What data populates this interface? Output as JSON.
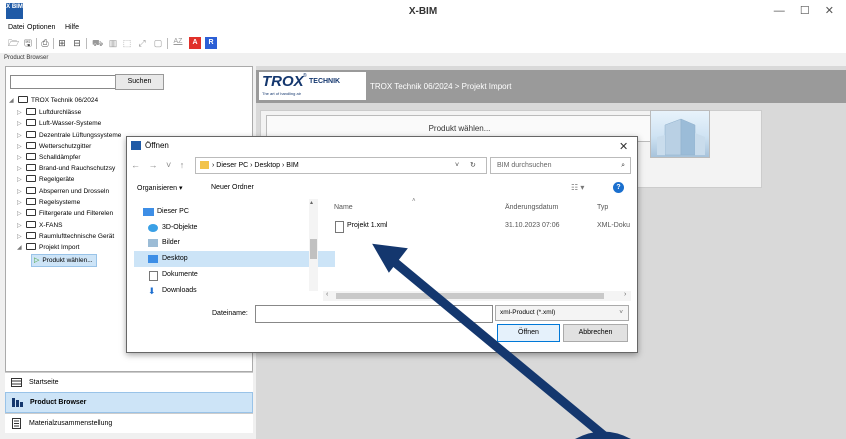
{
  "app": {
    "title": "X-BIM",
    "logo_text": "X BIM",
    "window_controls": "— ☐ ✕"
  },
  "menu": [
    "Datei",
    "Optionen",
    "Hilfe"
  ],
  "toolbar": {
    "icons": [
      "open-folder",
      "save",
      "print",
      "add-box",
      "expand-box",
      "cart",
      "product-list",
      "frame",
      "expand-arrow",
      "sort-az",
      "a-red",
      "r-blue"
    ],
    "az_label": "AZ",
    "a_label": "A",
    "r_label": "R",
    "accent_red": "#e0312b",
    "accent_blue": "#2c5fd5"
  },
  "product_browser_caption": "Product Browser",
  "search": {
    "value": "",
    "button_label": "Suchen"
  },
  "tree": {
    "root": "TROX Technik 06/2024",
    "items": [
      "Luftdurchlässe",
      "Luft-Wasser-Systeme",
      "Dezentrale Lüftungssysteme",
      "Wetterschutzgitter",
      "Schalldämpfer",
      "Brand-und Rauchschutzsy",
      "Regelgeräte",
      "Absperren und Drosseln",
      "Regelsysteme",
      "Filtergerate und Filterelen",
      "X-FANS",
      "Raumlufttechnische Gerät",
      "Projekt Import"
    ],
    "child": "Produkt wählen..."
  },
  "bottom_nav": [
    "Startseite",
    "Product Browser",
    "Materialzusammenstellung"
  ],
  "trox": {
    "word": "TROX",
    "tech": "TECHNIK",
    "reg": "®",
    "tagline": "The art of handling air",
    "breadcrumb": "TROX Technik 06/2024 > Projekt Import",
    "produkt_button": "Produkt wählen..."
  },
  "dialog": {
    "title": "Öffnen",
    "nav_arrows": "← → ˅ ↑",
    "address_path": "› Dieser PC › Desktop › BIM",
    "search_placeholder": "BIM durchsuchen",
    "organisieren": "Organisieren ▾",
    "neuer_ordner": "Neuer Ordner",
    "sidebar": [
      "Dieser PC",
      "3D-Objekte",
      "Bilder",
      "Desktop",
      "Dokumente",
      "Downloads"
    ],
    "columns": [
      "Name",
      "Änderungsdatum",
      "Typ"
    ],
    "files": [
      {
        "name": "Projekt 1.xml",
        "date": "31.10.2023 07:06",
        "type": "XML-Doku"
      }
    ],
    "dateiname_label": "Dateiname:",
    "dateiname_value": "",
    "filetype": "xml-Product (*.xml)",
    "open_label": "Öffnen",
    "cancel_label": "Abbrechen"
  },
  "annotation_arrow_color": "#14376e"
}
